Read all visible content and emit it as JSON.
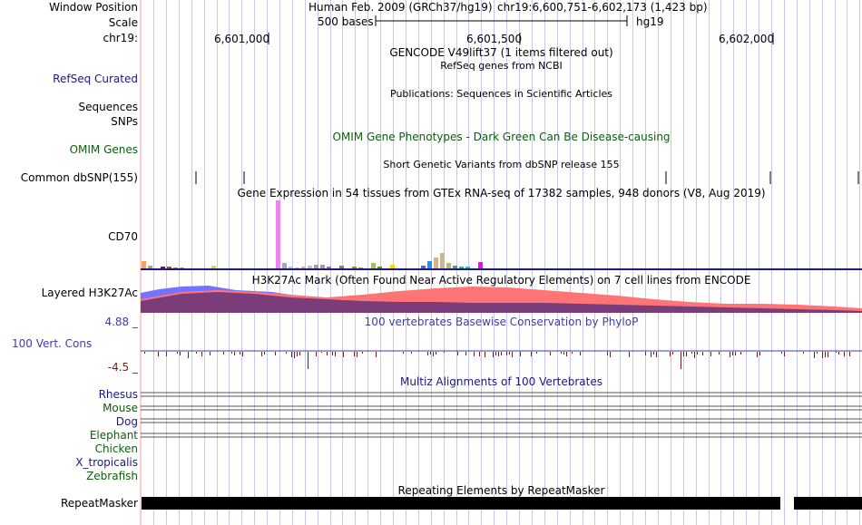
{
  "header": {
    "window_position_label": "Window Position",
    "assembly": "Human Feb. 2009 (GRCh37/hg19)",
    "position": "chr19:6,600,751-6,602,173 (1,423 bp)",
    "scale_label": "Scale",
    "scale_value": "500 bases",
    "scale_db": "hg19",
    "chrom_label": "chr19:",
    "ruler_ticks": [
      "6,601,000",
      "6,601,500",
      "6,602,000"
    ]
  },
  "tracks": {
    "gencode_title": "GENCODE V49lift37 (1 items filtered out)",
    "refseq_label": "RefSeq Curated",
    "refseq_title": "RefSeq genes from NCBI",
    "pubs_title": "Publications: Sequences in Scientific Articles",
    "sequences_label": "Sequences",
    "snps_label": "SNPs",
    "omim_label": "OMIM Genes",
    "omim_title": "OMIM Gene Phenotypes - Dark Green Can Be Disease-causing",
    "dbsnp_title": "Short Genetic Variants from dbSNP release 155",
    "dbsnp_label": "Common dbSNP(155)",
    "gtex_title": "Gene Expression in 54 tissues from GTEx RNA-seq of 17382 samples, 948 donors (V8, Aug 2019)",
    "gtex_label": "CD70",
    "h3k27ac_label": "Layered H3K27Ac",
    "h3k27ac_title": "H3K27Ac Mark (Often Found Near Active Regulatory Elements) on 7 cell lines from ENCODE",
    "cons_max": "4.88 _",
    "cons_label": "100 Vert. Cons",
    "cons_min": "-4.5 _",
    "cons_title": "100 vertebrates Basewise Conservation by PhyloP",
    "multiz_title": "Multiz Alignments of 100 Vertebrates",
    "species": [
      {
        "name": "Rhesus",
        "color": "#1a1a7a"
      },
      {
        "name": "Mouse",
        "color": "#0d5c0d"
      },
      {
        "name": "Dog",
        "color": "#1a1a7a"
      },
      {
        "name": "Elephant",
        "color": "#0d5c0d"
      },
      {
        "name": "Chicken",
        "color": "#0d5c0d"
      },
      {
        "name": "X_tropicalis",
        "color": "#1a1a7a"
      },
      {
        "name": "Zebrafish",
        "color": "#0d5c0d"
      }
    ],
    "repeatmasker_title": "Repeating Elements by RepeatMasker",
    "repeatmasker_label": "RepeatMasker"
  },
  "colors": {
    "grid_line": "#c8c8ea",
    "left_edge": "#e8a0a0",
    "h3k27ac_blue": "#7373ff",
    "h3k27ac_red": "#ff7575",
    "h3k27ac_overlap": "#7a3d7a",
    "gtex_highlight": "#ee82ee",
    "repeat_block": "#000000"
  }
}
